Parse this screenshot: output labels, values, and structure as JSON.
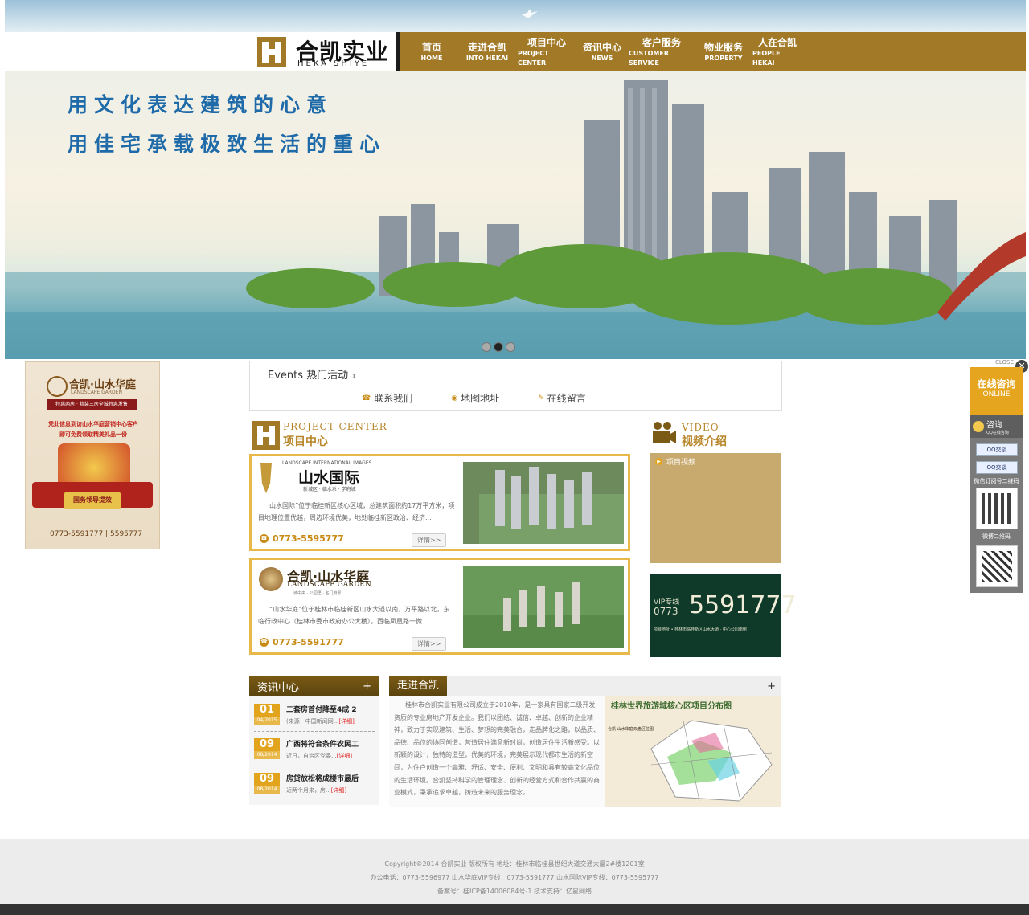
{
  "brand": {
    "name_cn": "合凯实业",
    "name_en": "HEKAISHIYE"
  },
  "nav": [
    {
      "cn": "首页",
      "en": "HOME"
    },
    {
      "cn": "走进合凯",
      "en": "INTO HEKAI"
    },
    {
      "cn": "项目中心",
      "en": "PROJECT CENTER"
    },
    {
      "cn": "资讯中心",
      "en": "NEWS"
    },
    {
      "cn": "客户服务",
      "en": "CUSTOMER SERVICE"
    },
    {
      "cn": "物业服务",
      "en": "PROPERTY"
    },
    {
      "cn": "人在合凯",
      "en": "PEOPLE HEKAI"
    }
  ],
  "banner": {
    "slogan1": "用文化表达建筑的心意",
    "slogan2": "用佳宅承载极致生活的重心",
    "slides": 3,
    "active_slide": 2
  },
  "left_ad": {
    "title": "合凯·山水华庭",
    "subtitle": "LANDSCAPE GARDEN",
    "tagline": "特惠两房 · 精装三房全城特惠发售",
    "promo1": "凭此信息到访山水华庭营销中心客户",
    "promo2": "即可免费领取精美礼品一份",
    "ribbon": "国务领导提效",
    "phones": "0773-5591777 | 5595777"
  },
  "events": {
    "title": "Events 热门活动",
    "links": [
      "联系我们",
      "地图地址",
      "在线留言"
    ]
  },
  "project_center": {
    "en": "PROJECT CENTER",
    "cn": "项目中心",
    "items": [
      {
        "brand_top": "LANDSCAPE INTERNATIONAL IMAGES",
        "brand": "山水国际",
        "brand_sub": "新城区 · 临水系 · 学府城",
        "desc": "山水国际”位于临桂新区核心区域，总建筑面积约17万平方米，项目地理位置优越，周边环境优美，地处临桂新区政治、经济...",
        "phone": "0773-5595777",
        "detail": "详情>>"
      },
      {
        "brand_top": "",
        "brand": "合凯·山水华庭",
        "brand_sub": "LANDSCAPE GARDEN",
        "brand_note": "城中央 · 公园里 · 名门府邸",
        "desc": "“山水华庭”位于桂林市临桂新区山水大道以南，万平路以北，东临行政中心（桂林市委市政府办公大楼），西临凤凰路一微...",
        "phone": "0773-5591777",
        "detail": "详情>>"
      }
    ]
  },
  "video": {
    "en": "VIDEO",
    "cn": "视频介绍",
    "label": "项目视频"
  },
  "vip": {
    "label1": "VIP专线",
    "label2": "0773",
    "number": "5591777",
    "address": "项目地址 • 桂林市临桂新区山水大道 · 中心公园南侧"
  },
  "news": {
    "title": "资讯中心",
    "more": "+",
    "items": [
      {
        "day": "01",
        "ym": "04/2015",
        "title": "二套房首付降至4成 2",
        "summary": "(来源：中国新闻网...",
        "detail": "[详细]"
      },
      {
        "day": "09",
        "ym": "08/2014",
        "title": "广西将符合条件农民工",
        "summary": "近日，自治区党委...",
        "detail": "[详细]"
      },
      {
        "day": "09",
        "ym": "08/2014",
        "title": "房贷放松将成楼市最后",
        "summary": "近两个月来，房...",
        "detail": "[详细]"
      }
    ]
  },
  "about": {
    "title": "走进合凯",
    "more": "+",
    "text": "桂林市合凯实业有限公司成立于2010年，是一家具有国家二级开发资质的专业房地产开发企业。我们以团结、诚信、卓越、创新的企业精神，致力于实现建筑、生活、梦想的完美融合，走品牌化之路，以品质、品德、品位的协同创造，营造居住满意新时尚，创造居住生活新感受。以新颖的设计，独特的造型，优美的环境，完美展示现代都市生活的新空间，为住户创造一个高雅、舒适、安全、便利、文明和具有较高文化品位的生活环境。合凯坚持科学的管理理念、创新的经营方式和合作共赢的商业模式，秉承追求卓越，铸造未来的服务理念，...",
    "map_title": "桂林世界旅游城核心区项目分布图",
    "map_labels": [
      "合凯·山水华庭",
      "双盘区位图"
    ]
  },
  "footer": {
    "line1": "Copyright©2014 合凯实业 版权所有 地址：桂林市临桂县世纪大道交通大厦2#楼1201室",
    "line2": "办公电话：0773-5596977 山水华庭VIP专线：0773-5591777 山水国际VIP专线：0773-5595777",
    "line3": "备案号：桂ICP备14006084号-1   技术支持：亿星网络"
  },
  "float_panel": {
    "close": "CLOSE",
    "title_cn": "在线咨询",
    "title_en": "ONLINE",
    "qq_title": "咨询",
    "qq_sub": "QQ在线咨询",
    "qq_btn": "QQ交谈",
    "qr1": "微信订阅号二维码",
    "qr2": "微博二维码"
  },
  "colors": {
    "gold": "#a27a27",
    "accent": "#e2a41c",
    "blue_slogan": "#1f6aa8",
    "vip_green": "#0f3a2a"
  }
}
